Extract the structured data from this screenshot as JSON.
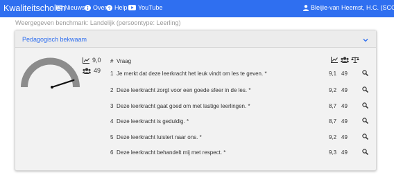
{
  "nav": {
    "brand": "Kwaliteitscholen",
    "items": [
      {
        "label": "Nieuws",
        "icon": "newspaper-icon"
      },
      {
        "label": "Over",
        "icon": "info-icon"
      },
      {
        "label": "Help",
        "icon": "help-icon"
      },
      {
        "label": "YouTube",
        "icon": "youtube-icon"
      }
    ],
    "user": "Bleijie-van Heemst, H.C. (SCOL)",
    "color": "#2f6ff0"
  },
  "benchmark_text": "Weergegeven benchmark: Landelijk (persoontype: Leerling)",
  "card": {
    "title": "Pedagogisch bekwaam",
    "score": "9,0",
    "respondents": "49",
    "gauge_level": 0.9,
    "table": {
      "col_num": "#",
      "col_question": "Vraag",
      "rows": [
        {
          "num": "1",
          "question": "Je merkt dat deze leerkracht het leuk vindt om les te geven. *",
          "score": "9,1",
          "count": "49"
        },
        {
          "num": "2",
          "question": "Deze leerkracht zorgt voor een goede sfeer in de les. *",
          "score": "9,2",
          "count": "49"
        },
        {
          "num": "3",
          "question": "Deze leerkracht gaat goed om met lastige leerlingen. *",
          "score": "8,7",
          "count": "49"
        },
        {
          "num": "4",
          "question": "Deze leerkracht is geduldig. *",
          "score": "8,7",
          "count": "49"
        },
        {
          "num": "5",
          "question": "Deze leerkracht luistert naar ons. *",
          "score": "9,2",
          "count": "49"
        },
        {
          "num": "6",
          "question": "Deze leerkracht behandelt mij met respect. *",
          "score": "9,3",
          "count": "49"
        }
      ]
    }
  }
}
